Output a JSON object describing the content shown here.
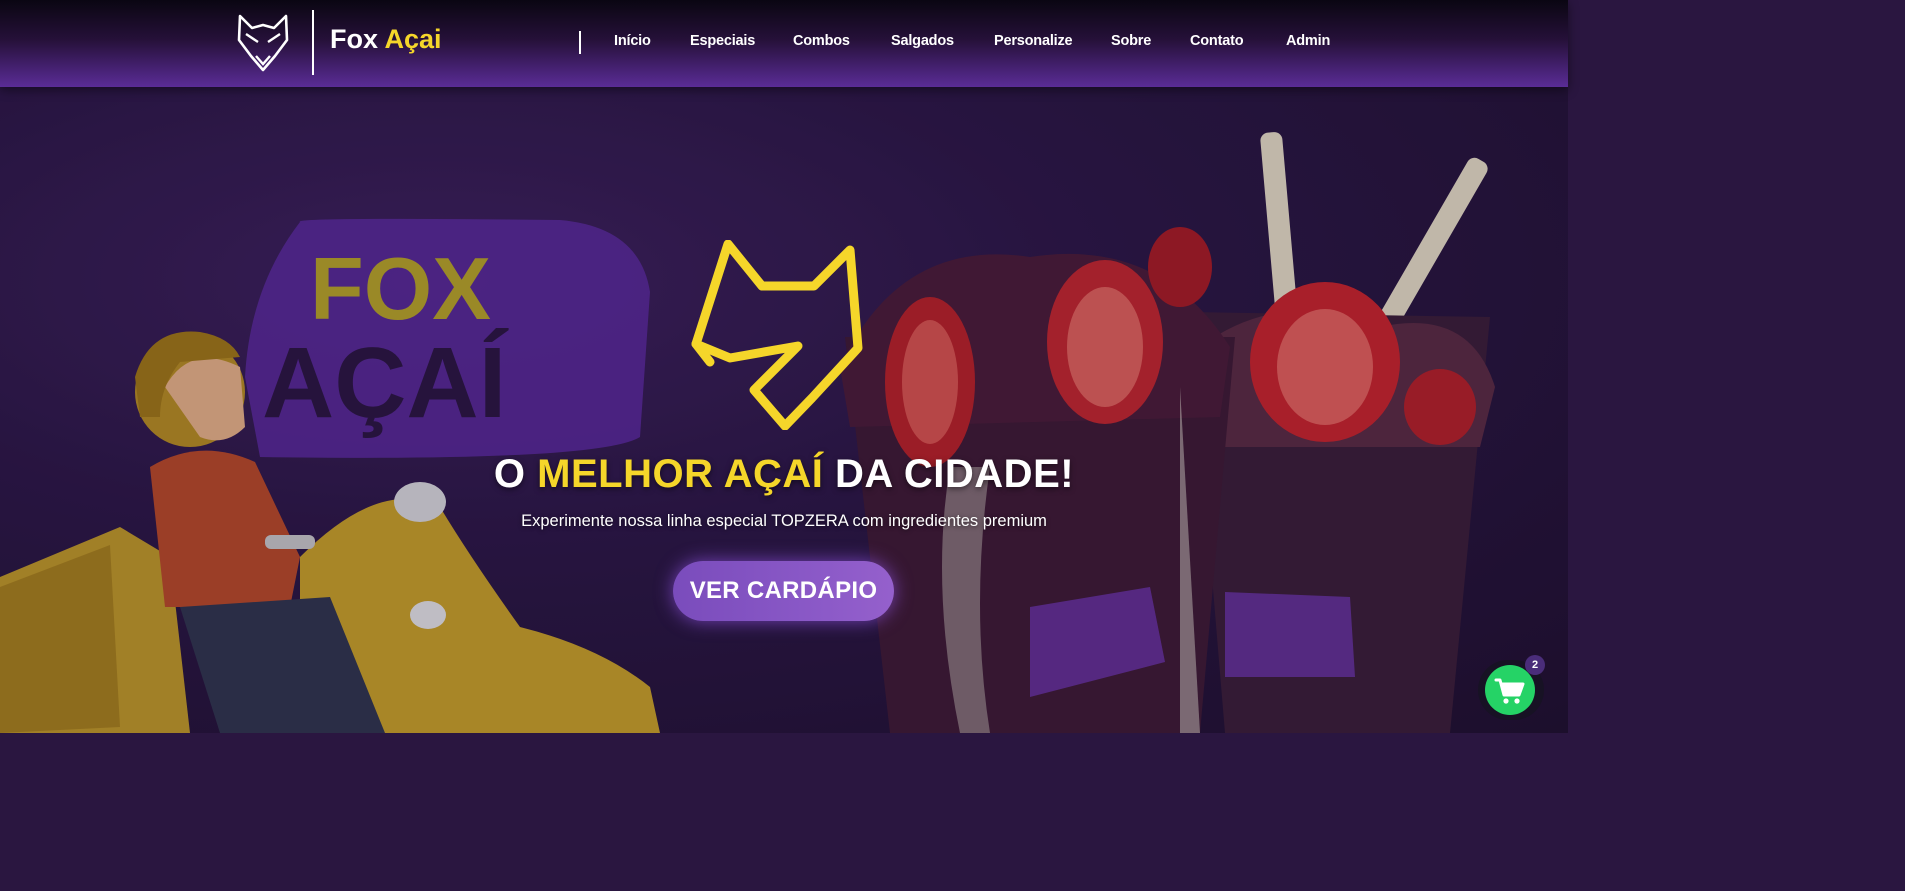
{
  "header": {
    "brand_name": "Fox",
    "brand_accent": "Açai",
    "nav": [
      {
        "label": "Início"
      },
      {
        "label": "Especiais"
      },
      {
        "label": "Combos"
      },
      {
        "label": "Salgados"
      },
      {
        "label": "Personalize"
      },
      {
        "label": "Sobre"
      },
      {
        "label": "Contato"
      },
      {
        "label": "Admin"
      }
    ]
  },
  "hero": {
    "headline_start": "O ",
    "headline_highlight": "MELHOR AÇAÍ",
    "headline_end": " DA CIDADE!",
    "subtitle": "Experimente nossa linha especial TOPZERA com ingredientes premium",
    "cta_label": "VER CARDÁPIO",
    "art_logo_line1": "FOX",
    "art_logo_line2": "AÇAÍ"
  },
  "cart": {
    "count": "2"
  },
  "colors": {
    "accent_yellow": "#f5d62a",
    "brand_purple": "#6a34a8",
    "cta_purple": "#8c5ac8",
    "cart_green": "#25d366"
  },
  "icons": {
    "logo": "fox-head-icon",
    "cart": "shopping-cart-icon"
  }
}
